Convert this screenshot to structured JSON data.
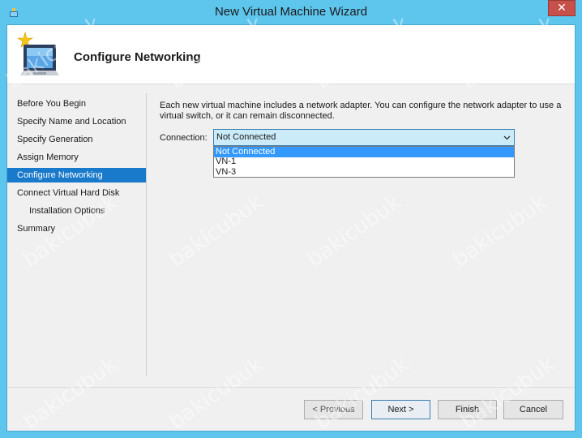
{
  "window": {
    "title": "New Virtual Machine Wizard",
    "close_glyph": "✕"
  },
  "header": {
    "title": "Configure Networking"
  },
  "sidebar": {
    "items": [
      {
        "label": "Before You Begin"
      },
      {
        "label": "Specify Name and Location"
      },
      {
        "label": "Specify Generation"
      },
      {
        "label": "Assign Memory"
      },
      {
        "label": "Configure Networking"
      },
      {
        "label": "Connect Virtual Hard Disk"
      },
      {
        "label": "Installation Options"
      },
      {
        "label": "Summary"
      }
    ]
  },
  "main": {
    "description": "Each new virtual machine includes a network adapter. You can configure the network adapter to use a virtual switch, or it can remain disconnected.",
    "connection_label": "Connection:",
    "connection_value": "Not Connected",
    "options": [
      "Not Connected",
      "VN-1",
      "VN-3"
    ]
  },
  "buttons": {
    "previous": "< Previous",
    "next": "Next >",
    "finish": "Finish",
    "cancel": "Cancel"
  },
  "watermark": "bakicubuk",
  "colors": {
    "titlebar": "#5ec5ed",
    "active_nav": "#1979ca",
    "selected_option": "#3399ff",
    "close_button": "#c7504a"
  }
}
